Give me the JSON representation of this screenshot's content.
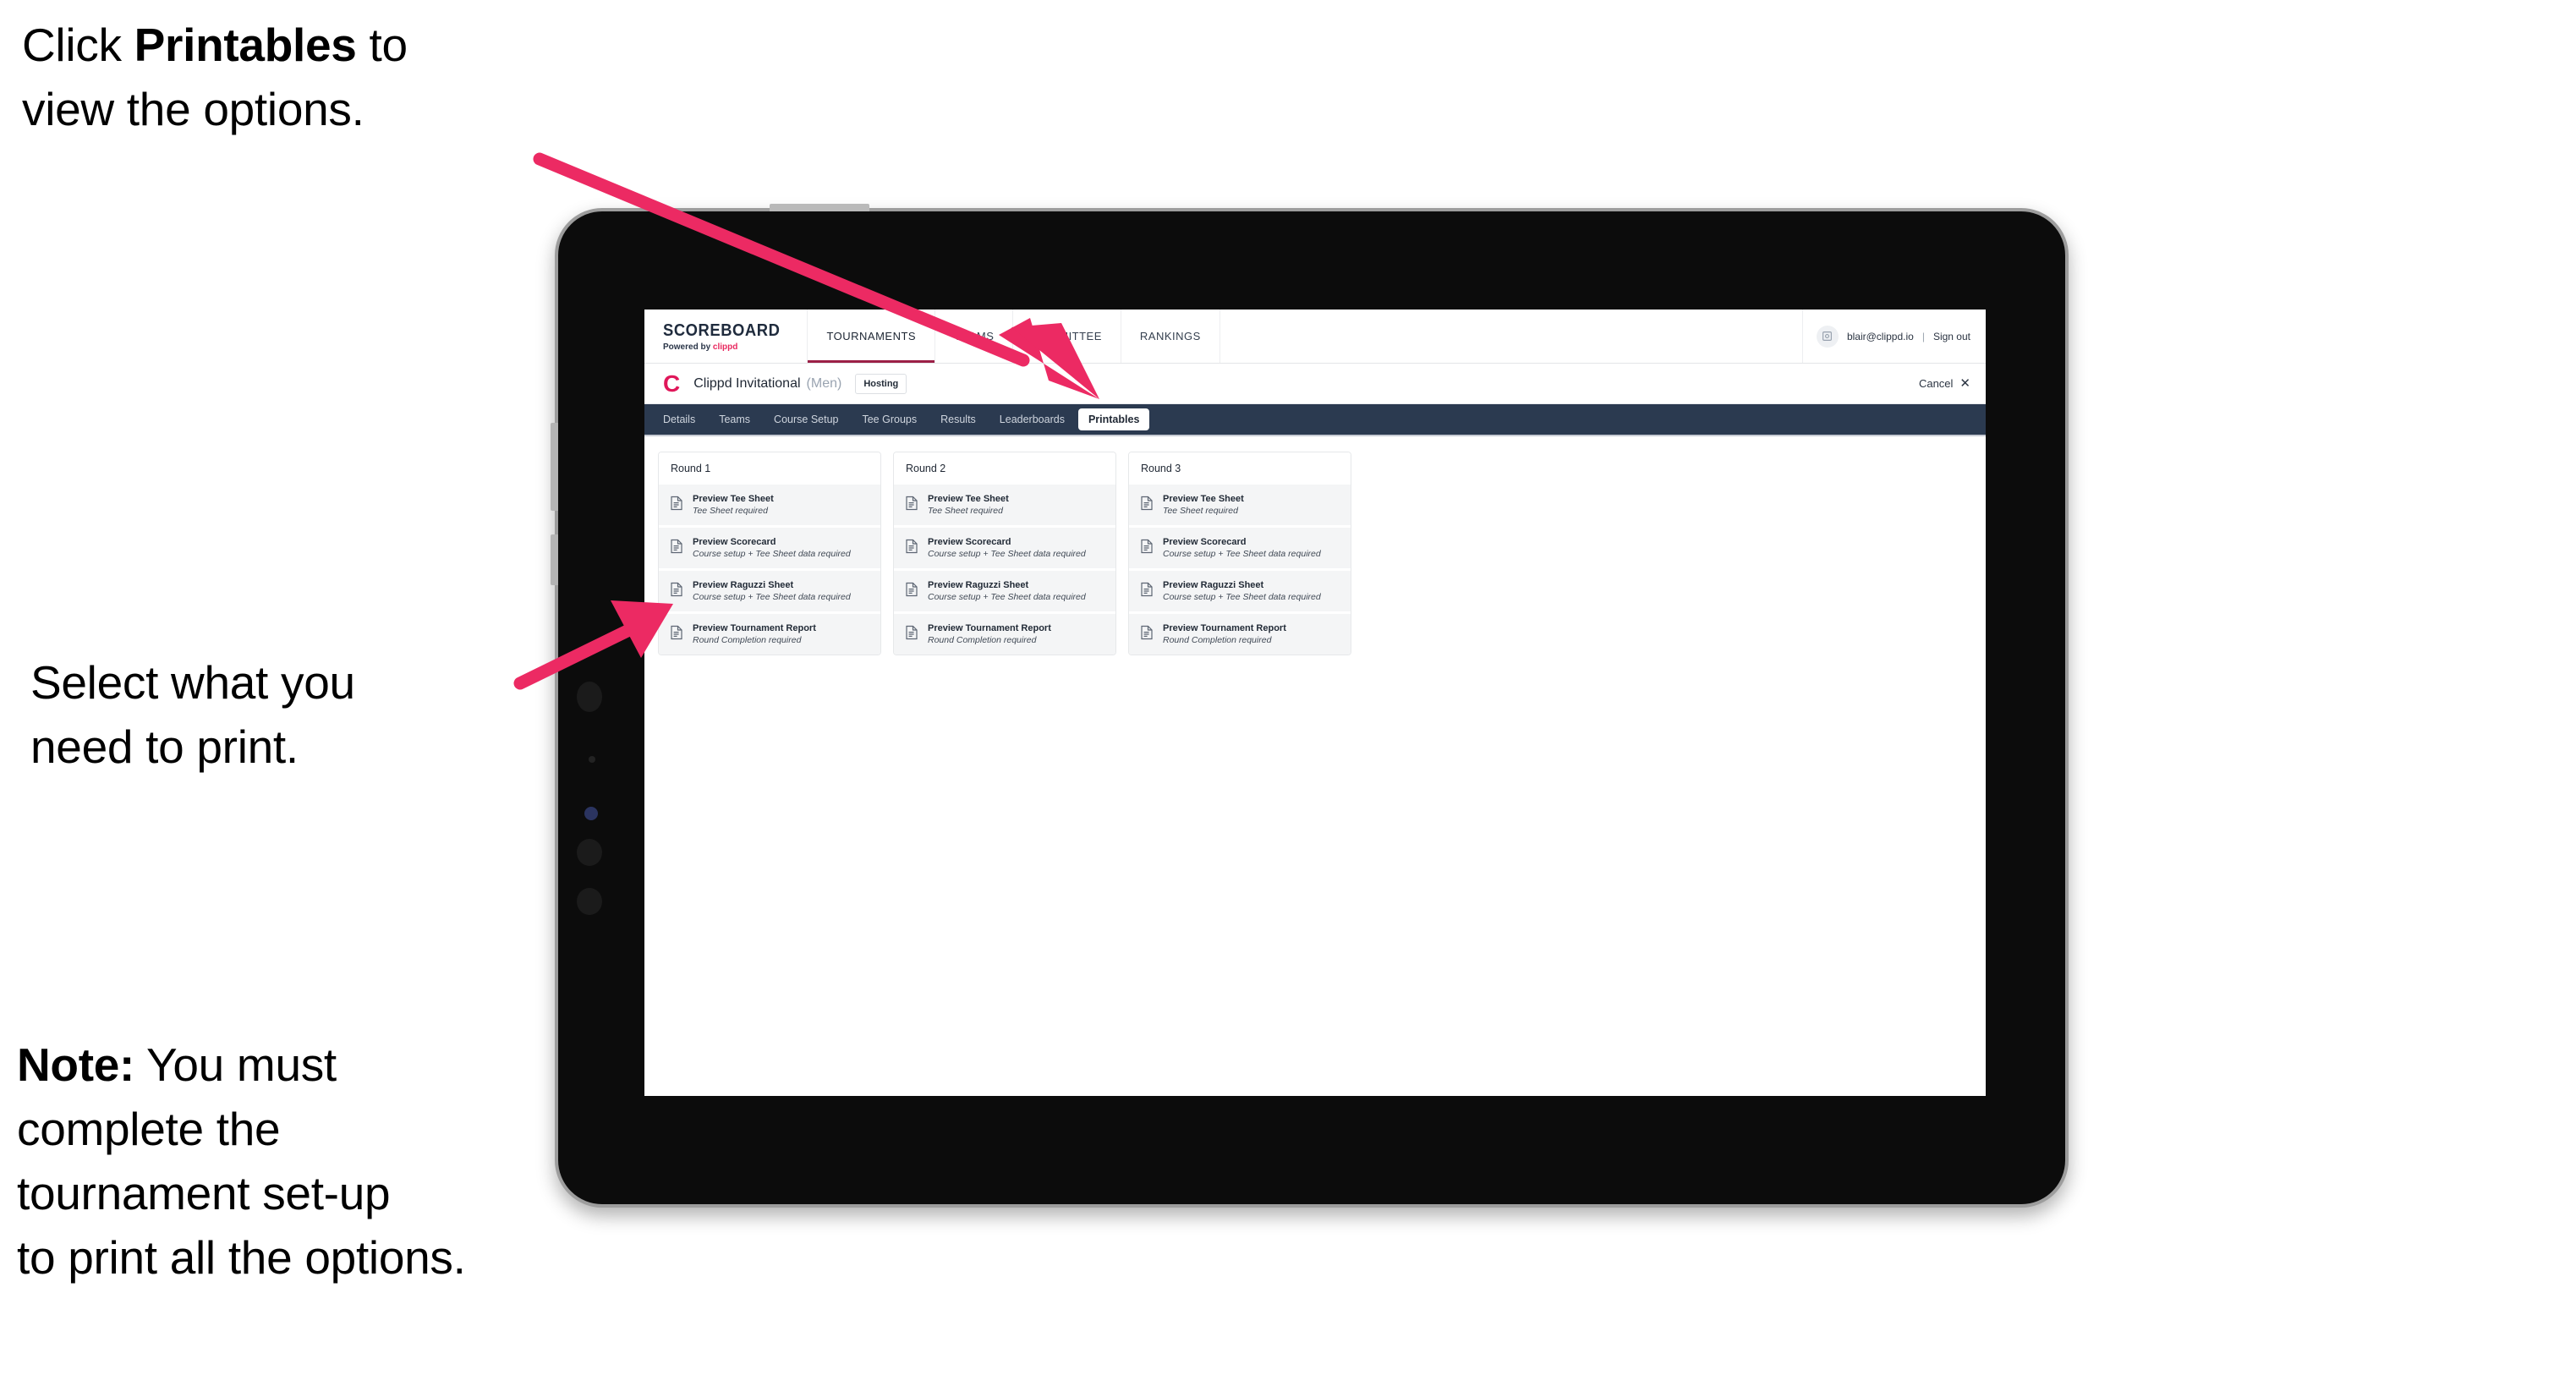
{
  "annotations": {
    "callout_1_prefix": "Click ",
    "callout_1_bold": "Printables",
    "callout_1_suffix": " to\nview the options.",
    "callout_2": "Select what you\n need to print.",
    "callout_3_bold": "Note:",
    "callout_3_rest": " You must\ncomplete the\ntournament set-up\nto print all the options.",
    "arrow_color": "#ec2a63"
  },
  "topbar": {
    "brand_title": "SCOREBOARD",
    "brand_sub_prefix": "Powered by ",
    "brand_sub_brand": "clippd",
    "nav_items": [
      {
        "label": "TOURNAMENTS",
        "active": true
      },
      {
        "label": "TEAMS",
        "active": false
      },
      {
        "label": "COMMITTEE",
        "active": false
      },
      {
        "label": "RANKINGS",
        "active": false
      }
    ],
    "avatar_icon": "user-avatar-icon",
    "user_email": "blair@clippd.io",
    "separator": "|",
    "sign_out": "Sign out",
    "active_underline_color": "#9b1f46"
  },
  "tournament_bar": {
    "logo_letter": "C",
    "logo_color": "#e0175a",
    "name": "Clippd Invitational",
    "gender": "(Men)",
    "status_badge": "Hosting",
    "cancel_label": "Cancel",
    "cancel_icon": "close-x-icon"
  },
  "subnav": {
    "background": "#2b3a50",
    "items": [
      {
        "label": "Details",
        "active": false
      },
      {
        "label": "Teams",
        "active": false
      },
      {
        "label": "Course Setup",
        "active": false
      },
      {
        "label": "Tee Groups",
        "active": false
      },
      {
        "label": "Results",
        "active": false
      },
      {
        "label": "Leaderboards",
        "active": false
      },
      {
        "label": "Printables",
        "active": true
      }
    ]
  },
  "rounds": [
    {
      "title": "Round 1",
      "items": [
        {
          "title": "Preview Tee Sheet",
          "sub": "Tee Sheet required"
        },
        {
          "title": "Preview Scorecard",
          "sub": "Course setup + Tee Sheet data required"
        },
        {
          "title": "Preview Raguzzi Sheet",
          "sub": "Course setup + Tee Sheet data required"
        },
        {
          "title": "Preview Tournament Report",
          "sub": "Round Completion required"
        }
      ]
    },
    {
      "title": "Round 2",
      "items": [
        {
          "title": "Preview Tee Sheet",
          "sub": "Tee Sheet required"
        },
        {
          "title": "Preview Scorecard",
          "sub": "Course setup + Tee Sheet data required"
        },
        {
          "title": "Preview Raguzzi Sheet",
          "sub": "Course setup + Tee Sheet data required"
        },
        {
          "title": "Preview Tournament Report",
          "sub": "Round Completion required"
        }
      ]
    },
    {
      "title": "Round 3",
      "items": [
        {
          "title": "Preview Tee Sheet",
          "sub": "Tee Sheet required"
        },
        {
          "title": "Preview Scorecard",
          "sub": "Course setup + Tee Sheet data required"
        },
        {
          "title": "Preview Raguzzi Sheet",
          "sub": "Course setup + Tee Sheet data required"
        },
        {
          "title": "Preview Tournament Report",
          "sub": "Round Completion required"
        }
      ]
    }
  ]
}
